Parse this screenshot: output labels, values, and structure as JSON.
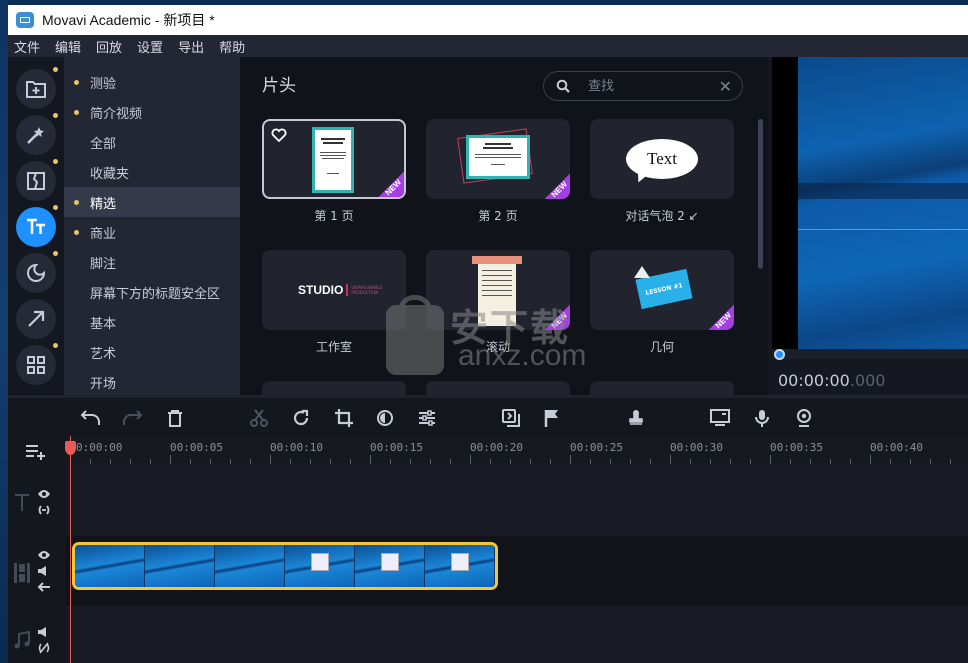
{
  "window": {
    "title": "Movavi Academic - 新项目 *"
  },
  "menu": [
    "文件",
    "编辑",
    "回放",
    "设置",
    "导出",
    "帮助"
  ],
  "iconbar": [
    {
      "name": "import-icon",
      "active": false,
      "dot": true
    },
    {
      "name": "magic-wand-icon",
      "active": false,
      "dot": true
    },
    {
      "name": "transitions-icon",
      "active": false,
      "dot": true
    },
    {
      "name": "titles-icon",
      "active": true,
      "dot": true
    },
    {
      "name": "stickers-icon",
      "active": false,
      "dot": true
    },
    {
      "name": "callouts-arrow-icon",
      "active": false,
      "dot": false
    },
    {
      "name": "more-grid-icon",
      "active": false,
      "dot": true
    }
  ],
  "categories": [
    {
      "label": "测验",
      "dot": true,
      "selected": false
    },
    {
      "label": "简介视频",
      "dot": true,
      "selected": false
    },
    {
      "label": "全部",
      "dot": false,
      "selected": false
    },
    {
      "label": "收藏夹",
      "dot": false,
      "selected": false
    },
    {
      "label": "精选",
      "dot": true,
      "selected": true
    },
    {
      "label": "商业",
      "dot": true,
      "selected": false
    },
    {
      "label": "脚注",
      "dot": false,
      "selected": false
    },
    {
      "label": "屏幕下方的标题安全区",
      "dot": false,
      "selected": false
    },
    {
      "label": "基本",
      "dot": false,
      "selected": false
    },
    {
      "label": "艺术",
      "dot": false,
      "selected": false
    },
    {
      "label": "开场",
      "dot": false,
      "selected": false
    }
  ],
  "gallery": {
    "title": "片头",
    "search": {
      "placeholder": "查找",
      "value": ""
    },
    "items": [
      {
        "label": "第 1 页",
        "new": true,
        "selected": true,
        "favorite_icon": true
      },
      {
        "label": "第 2 页",
        "new": true,
        "selected": false
      },
      {
        "label": "对话气泡 2 ↙",
        "new": false,
        "selected": false,
        "thumb_text": "Text"
      },
      {
        "label": "工作室",
        "new": false,
        "selected": false,
        "thumb_text": "STUDIO",
        "thumb_sub": "UNIMAGINABLE PRODUCTION"
      },
      {
        "label": "滚动",
        "new": true,
        "selected": false
      },
      {
        "label": "几何",
        "new": true,
        "selected": false,
        "thumb_text": "LESSON #1"
      }
    ]
  },
  "preview": {
    "time_main": "00:00:00",
    "time_ms": ".000",
    "position": 0
  },
  "toolbar": [
    "undo-icon",
    "redo-icon",
    "delete-icon",
    "cut-icon",
    "rotate-icon",
    "crop-icon",
    "color-adjust-icon",
    "settings-sliders-icon",
    "overlay-icon",
    "marker-flag-icon",
    "stamp-icon",
    "screen-record-icon",
    "microphone-icon",
    "webcam-icon"
  ],
  "timeline": {
    "ruler": [
      "0:00:00",
      "00:00:05",
      "00:00:10",
      "00:00:15",
      "00:00:20",
      "00:00:25",
      "00:00:30",
      "00:00:35",
      "00:00:40"
    ],
    "tracks": [
      "text-track",
      "video-track",
      "audio-track"
    ],
    "clip_frames": 6
  },
  "watermark": {
    "text": "安下载",
    "domain": "anxz.com"
  }
}
